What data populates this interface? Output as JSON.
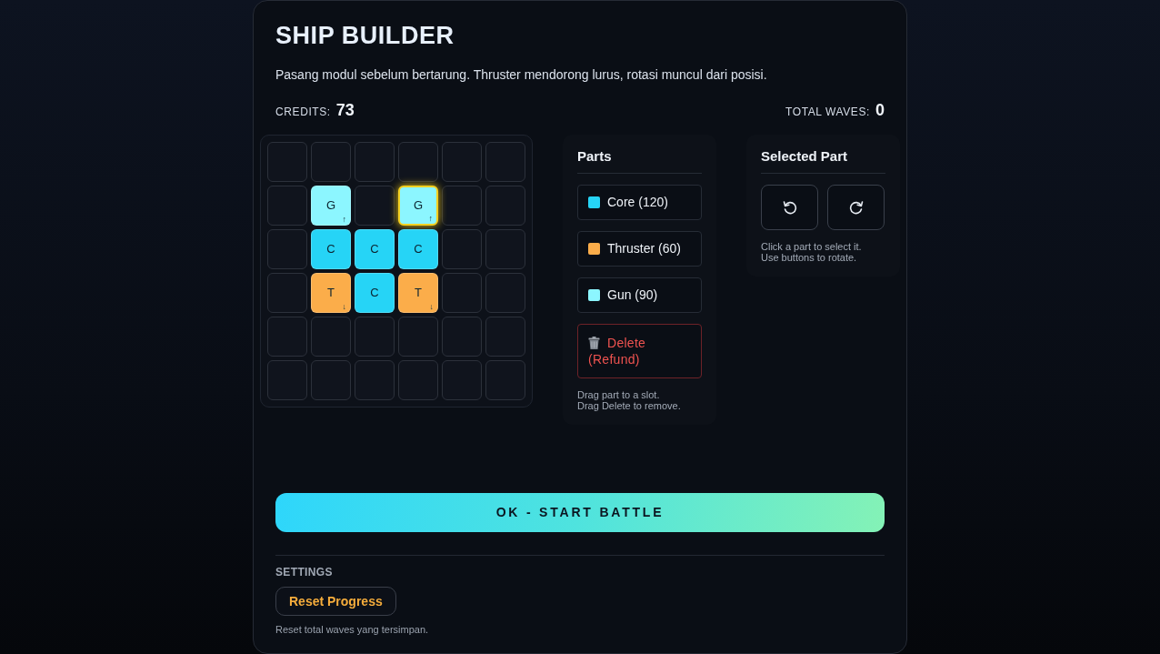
{
  "title": "SHIP BUILDER",
  "description": "Pasang modul sebelum bertarung. Thruster mendorong lurus, rotasi muncul dari posisi.",
  "stats": [
    {
      "label": "CREDITS:",
      "value": "73"
    },
    {
      "label": "TOTAL WAVES:",
      "value": "0"
    }
  ],
  "grid": {
    "rows": [
      [
        {
          "kind": "empty",
          "selected": false
        },
        {
          "kind": "empty",
          "selected": false
        },
        {
          "kind": "empty",
          "selected": false
        },
        {
          "kind": "empty",
          "selected": false
        },
        {
          "kind": "empty",
          "selected": false
        },
        {
          "kind": "empty",
          "selected": false
        }
      ],
      [
        {
          "kind": "empty",
          "selected": false
        },
        {
          "kind": "part",
          "letter": "G",
          "arrow": "↑",
          "color": "#8cf6ff",
          "selected": false
        },
        {
          "kind": "empty",
          "selected": false
        },
        {
          "kind": "part",
          "letter": "G",
          "arrow": "↑",
          "color": "#8cf6ff",
          "selected": true
        },
        {
          "kind": "empty",
          "selected": false
        },
        {
          "kind": "empty",
          "selected": false
        }
      ],
      [
        {
          "kind": "empty",
          "selected": false
        },
        {
          "kind": "part",
          "letter": "C",
          "color": "#26d4f6",
          "selected": false
        },
        {
          "kind": "part",
          "letter": "C",
          "color": "#26d4f6",
          "selected": false
        },
        {
          "kind": "part",
          "letter": "C",
          "color": "#26d4f6",
          "selected": false
        },
        {
          "kind": "empty",
          "selected": false
        },
        {
          "kind": "empty",
          "selected": false
        }
      ],
      [
        {
          "kind": "empty",
          "selected": false
        },
        {
          "kind": "part",
          "letter": "T",
          "arrow": "↓",
          "color": "#fbad4a",
          "selected": false
        },
        {
          "kind": "part",
          "letter": "C",
          "color": "#26d4f6",
          "selected": false
        },
        {
          "kind": "part",
          "letter": "T",
          "arrow": "↓",
          "color": "#fbad4a",
          "selected": false
        },
        {
          "kind": "empty",
          "selected": false
        },
        {
          "kind": "empty",
          "selected": false
        }
      ],
      [
        {
          "kind": "empty",
          "selected": false
        },
        {
          "kind": "empty",
          "selected": false
        },
        {
          "kind": "empty",
          "selected": false
        },
        {
          "kind": "empty",
          "selected": false
        },
        {
          "kind": "empty",
          "selected": false
        },
        {
          "kind": "empty",
          "selected": false
        }
      ],
      [
        {
          "kind": "empty",
          "selected": false
        },
        {
          "kind": "empty",
          "selected": false
        },
        {
          "kind": "empty",
          "selected": false
        },
        {
          "kind": "empty",
          "selected": false
        },
        {
          "kind": "empty",
          "selected": false
        },
        {
          "kind": "empty",
          "selected": false
        }
      ]
    ]
  },
  "parts_panel": {
    "title": "Parts",
    "items": [
      {
        "kind": "part",
        "label": "Core (120)",
        "color": "#26d4f6"
      },
      {
        "kind": "part",
        "label": "Thruster (60)",
        "color": "#fbad4a"
      },
      {
        "kind": "part",
        "label": "Gun (90)",
        "color": "#8cf6ff"
      },
      {
        "kind": "delete",
        "label": "Delete (Refund)"
      }
    ],
    "hint": "Drag part to a slot.\nDrag Delete to remove."
  },
  "selected_panel": {
    "title": "Selected Part",
    "buttons": [
      {
        "kind": "rotate_ccw"
      },
      {
        "kind": "rotate_cw"
      }
    ],
    "hint": "Click a part to select it.\nUse buttons to rotate."
  },
  "start_button": {
    "label": "OK - START BATTLE"
  },
  "settings": {
    "title": "SETTINGS",
    "button": "Reset Progress",
    "hint": "Reset total waves yang tersimpan."
  }
}
